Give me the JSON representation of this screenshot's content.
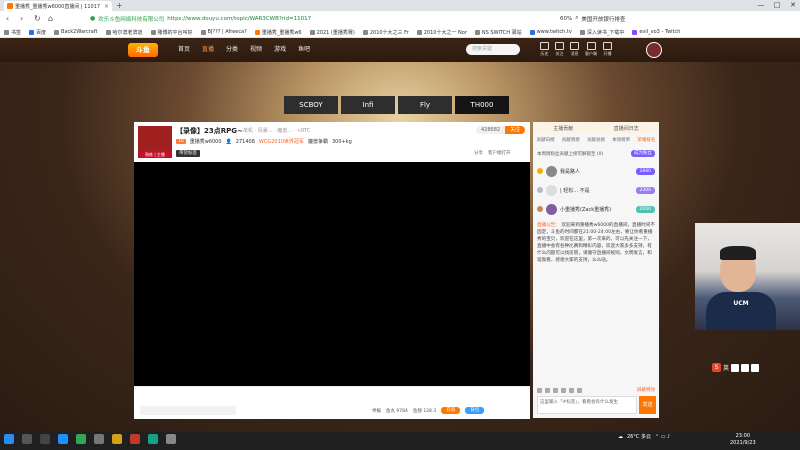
{
  "browser": {
    "tab_title": "重播秀_重播秀w6000直播间 | 11017",
    "new_tab": "+",
    "win_controls": [
      "—",
      "□",
      "✕"
    ],
    "url_site": "欢乐斗鱼网络科技有限公司",
    "url": "https://www.douyu.com/topic/WAR3CWB?rid=11017",
    "zoom": "60%",
    "search_hint": "美国开放银行排查",
    "bookmarks": [
      "书签",
      "百度",
      "Back2Warcraft",
      "哈尔滨老滨道",
      "赌博的平台叫好",
      "BJ??? | Afreeca?",
      "重播秀_重播秀w6",
      "2021 (重播秀赛)",
      "2010十大之三 Fr",
      "2010十大之一 Nor",
      "NS SWITCH 驿站",
      "www.twitch.tv",
      "深入读书_下载中",
      "evil_vo3 - Twitch"
    ]
  },
  "header": {
    "logo": "斗鱼",
    "nav": [
      "首页",
      "直播",
      "分类",
      "视频",
      "游戏",
      "鱼吧"
    ],
    "active_nav": "直播",
    "search_placeholder": "搜索关键",
    "icons": [
      {
        "name": "history-icon",
        "label": "历史"
      },
      {
        "name": "follow-icon",
        "label": "关注"
      },
      {
        "name": "message-icon",
        "label": "消息"
      },
      {
        "name": "download-icon",
        "label": "客户端"
      },
      {
        "name": "create-icon",
        "label": "开播"
      }
    ]
  },
  "streamer_tabs": [
    "SCBOY",
    "Infi",
    "Fly",
    "TH000"
  ],
  "active_streamer_tab": "TH000",
  "player": {
    "avatar_badge": "熟练 | 主播",
    "title": "【录像】23点RPG~",
    "meta": "单机 · 风暴... · 魔兽... · <RTC",
    "level": "10",
    "anchor": "重播秀w6000",
    "fans": "271408",
    "rank": "WCG2010世界冠军",
    "weekly": "魔兽争霸",
    "hot": "300+kg",
    "tag": "带货标签",
    "follow_count": "428682",
    "follow": "关注",
    "share": "分享",
    "client": "客户端打开",
    "report": "举报",
    "fish_ball": "鱼丸 9784",
    "fish_wing": "鱼翅 128.3",
    "pay": "充值",
    "gift": "背包"
  },
  "side": {
    "top": [
      "主播贡献",
      "直播间日志"
    ],
    "tabs": [
      "贡献日榜",
      "贡献周榜",
      "贡献总榜",
      "本场榜单",
      "荣耀排名"
    ],
    "notice_text": "本周周粉丝贡献上榜可解锁至 (0)",
    "notice_btn": "成为粉丝",
    "ranks": [
      {
        "name": "我是路人",
        "level": "2880"
      },
      {
        "name": "| 轻松... 不是",
        "level": "2300"
      },
      {
        "name": "小重播秀(Zack重播秀)",
        "level": "2000"
      }
    ],
    "bulletin_label": "直播公告：",
    "bulletin": "欢迎来到重播秀w6000的直播间，直播时间不固定，斗鱼的时间都在21:00-24:00左右，要让你看重播秀的宝贝，欢迎在这里，第一次来的，可以先关注一下，直播中会有各种比赛和精彩内容，欢迎大家多多支持，有什么问题可以找房管，请遵守直播间规则，文明发言，和谐观看，感谢大家的支持，么么哒。",
    "lock_label": "屏蔽特效",
    "chat_placeholder": "这里输入「#标签」，看看会有什么发生",
    "send": "发送"
  },
  "webcam": {
    "shirt_text": "UCM"
  },
  "taskbar": {
    "weather": "26°C 多云",
    "time": "23:00",
    "date": "2021/9/23",
    "ime": "英"
  }
}
